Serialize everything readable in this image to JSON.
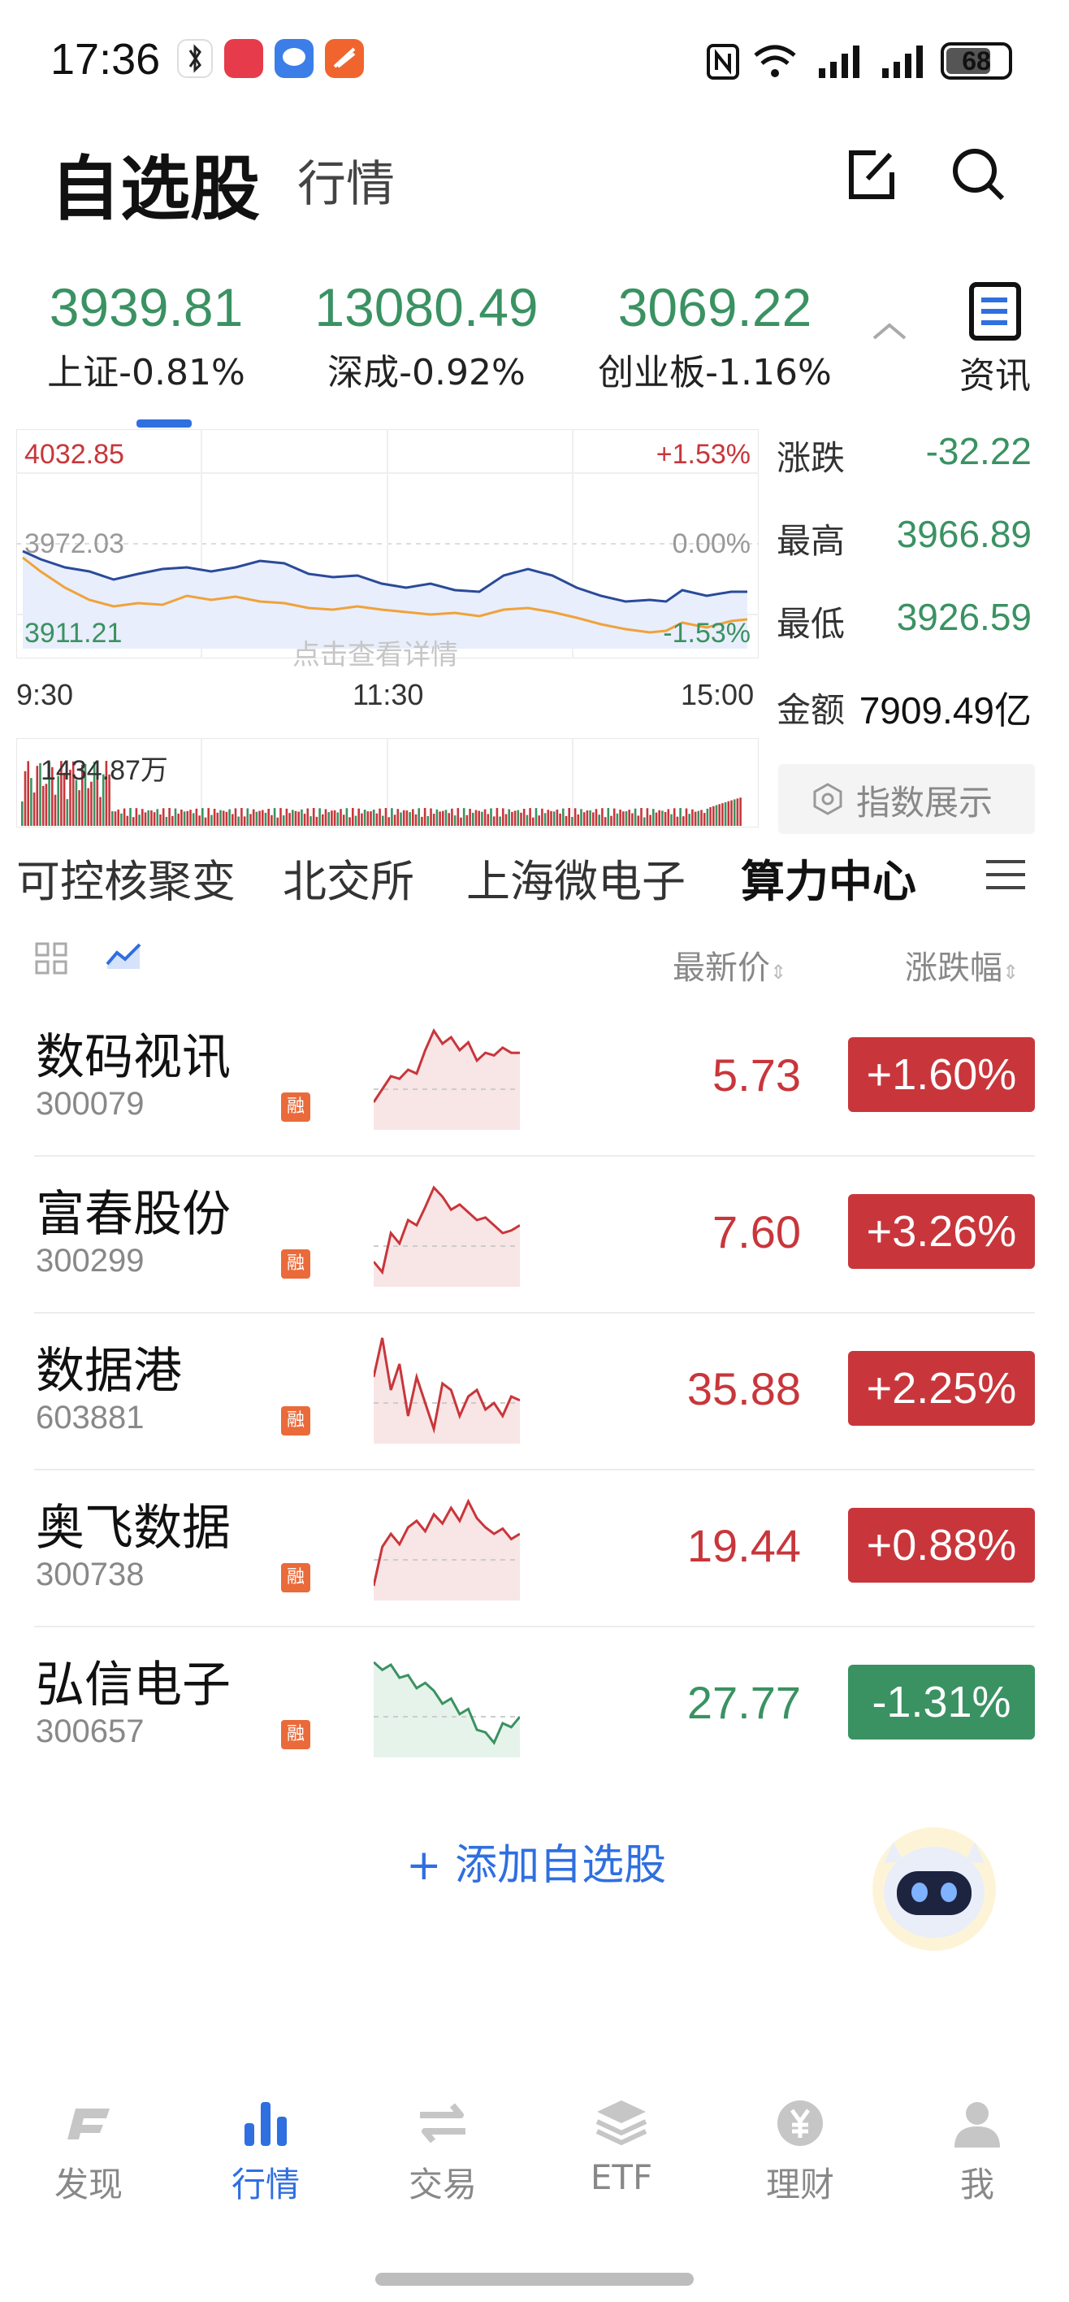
{
  "status_bar": {
    "time": "17:36",
    "battery": "68"
  },
  "header": {
    "title": "自选股",
    "subtitle": "行情",
    "edit_icon": "edit-icon",
    "search_icon": "search-icon"
  },
  "indices": [
    {
      "value": "3939.81",
      "name": "上证",
      "change": "-0.81%"
    },
    {
      "value": "13080.49",
      "name": "深成",
      "change": "-0.92%"
    },
    {
      "value": "3069.22",
      "name": "创业板",
      "change": "-1.16%"
    }
  ],
  "news": {
    "label": "资讯"
  },
  "chart": {
    "high_label": "4032.85",
    "mid_label": "3972.03",
    "low_label": "3911.21",
    "pct_high": "+1.53%",
    "pct_mid": "0.00%",
    "pct_low": "-1.53%",
    "hint": "点击查看详情",
    "time_start": "9:30",
    "time_mid": "11:30",
    "time_end": "15:00",
    "volume": "1434.87万"
  },
  "stats": {
    "change_label": "涨跌",
    "change_value": "-32.22",
    "high_label": "最高",
    "high_value": "3966.89",
    "low_label": "最低",
    "low_value": "3926.59",
    "amount_label": "金额",
    "amount_value": "7909.49亿",
    "index_display_button": "指数展示"
  },
  "categories": [
    "可控核聚变",
    "北交所",
    "上海微电子",
    "算力中心"
  ],
  "list_header": {
    "price": "最新价",
    "change": "涨跌幅"
  },
  "stocks": [
    {
      "name": "数码视讯",
      "code": "300079",
      "tag": "融",
      "price": "5.73",
      "change": "+1.60%",
      "dir": "up"
    },
    {
      "name": "富春股份",
      "code": "300299",
      "tag": "融",
      "price": "7.60",
      "change": "+3.26%",
      "dir": "up"
    },
    {
      "name": "数据港",
      "code": "603881",
      "tag": "融",
      "price": "35.88",
      "change": "+2.25%",
      "dir": "up"
    },
    {
      "name": "奥飞数据",
      "code": "300738",
      "tag": "融",
      "price": "19.44",
      "change": "+0.88%",
      "dir": "up"
    },
    {
      "name": "弘信电子",
      "code": "300657",
      "tag": "融",
      "price": "27.77",
      "change": "-1.31%",
      "dir": "down"
    }
  ],
  "add_button": "+ 添加自选股",
  "nav": [
    {
      "label": "发现",
      "icon": "discover-icon"
    },
    {
      "label": "行情",
      "icon": "market-icon"
    },
    {
      "label": "交易",
      "icon": "trade-icon"
    },
    {
      "label": "ETF",
      "icon": "etf-icon"
    },
    {
      "label": "理财",
      "icon": "finance-icon"
    },
    {
      "label": "我",
      "icon": "profile-icon"
    }
  ],
  "colors": {
    "up": "#c8363b",
    "down": "#3a9262",
    "accent": "#2f6fe0"
  }
}
